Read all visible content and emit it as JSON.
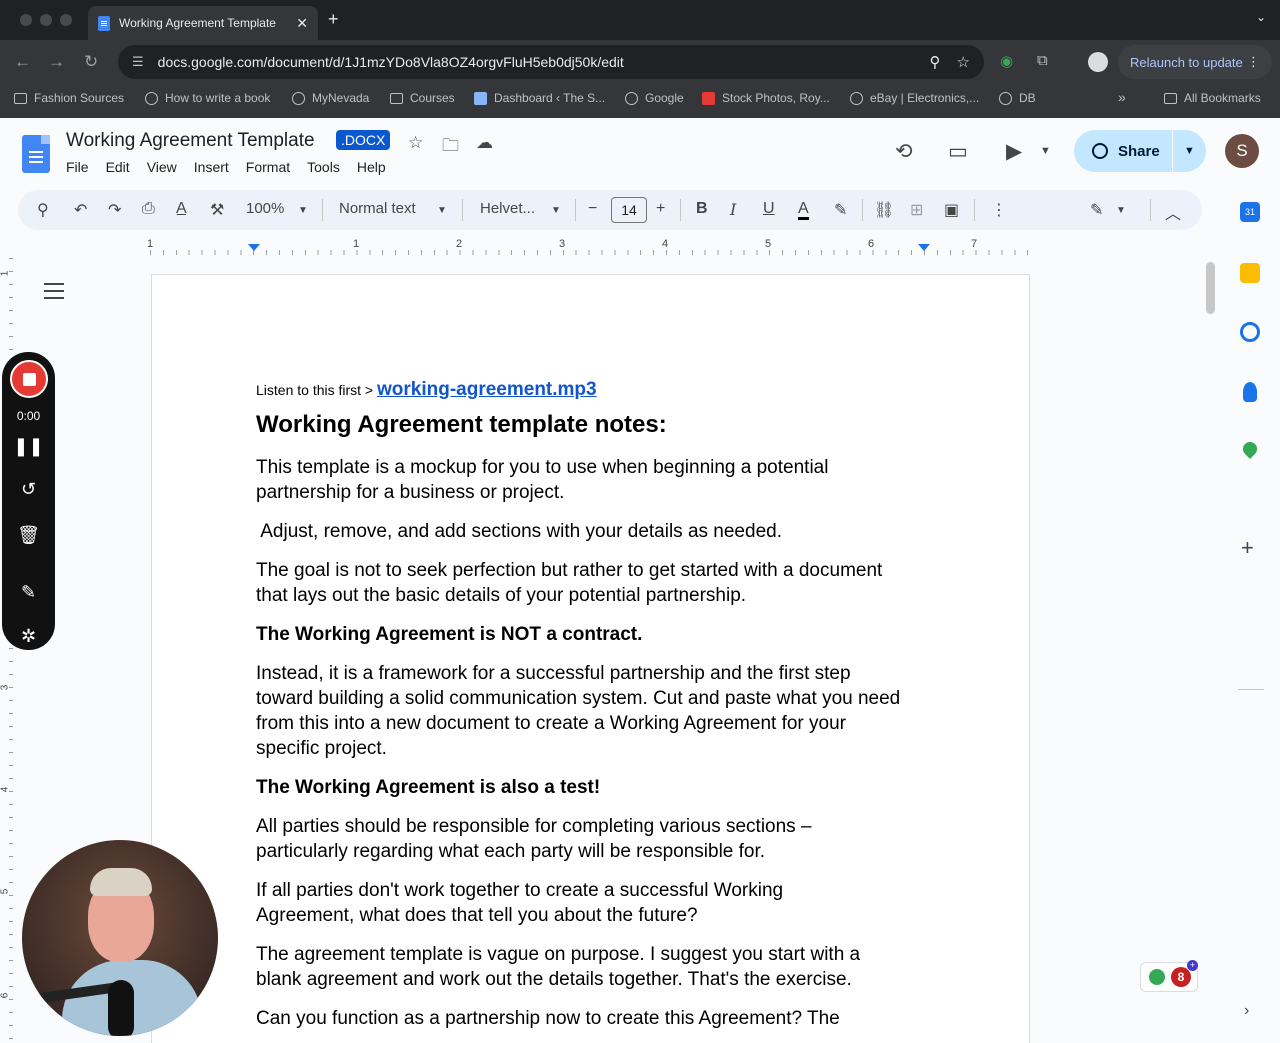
{
  "browser": {
    "tab_title": "Working Agreement Template",
    "tab_close": "✕",
    "new_tab": "+",
    "url": "docs.google.com/document/d/1J1mzYDo8Vla8OZ4orgvFluH5eb0dj50k/edit",
    "relaunch_label": "Relaunch to update",
    "bookmarks": [
      {
        "label": "Fashion Sources",
        "icon": "folder-icon"
      },
      {
        "label": "How to write a book",
        "icon": "globe-icon"
      },
      {
        "label": "MyNevada",
        "icon": "globe-icon"
      },
      {
        "label": "Courses",
        "icon": "folder-icon"
      },
      {
        "label": "Dashboard ‹ The S...",
        "icon": "site-icon"
      },
      {
        "label": "Google",
        "icon": "globe-icon"
      },
      {
        "label": "Stock Photos, Roy...",
        "icon": "site-icon"
      },
      {
        "label": "eBay | Electronics,...",
        "icon": "globe-icon"
      },
      {
        "label": "DB",
        "icon": "globe-icon"
      }
    ],
    "bookmarks_overflow": "»",
    "all_bookmarks": "All Bookmarks"
  },
  "docs": {
    "title": "Working Agreement Template",
    "format_badge": ".DOCX",
    "menu": [
      "File",
      "Edit",
      "View",
      "Insert",
      "Format",
      "Tools",
      "Help"
    ],
    "share_label": "Share",
    "avatar_initial": "S"
  },
  "toolbar": {
    "zoom": "100%",
    "style": "Normal text",
    "font": "Helvet...",
    "font_size": "14"
  },
  "ruler": {
    "numbers": [
      "1",
      "1",
      "2",
      "3",
      "4",
      "5",
      "6",
      "7"
    ],
    "vnumbers": [
      "1",
      "3",
      "4",
      "5",
      "6"
    ]
  },
  "recorder": {
    "time": "0:00"
  },
  "tracker_badge": "8",
  "document": {
    "listen_prefix": "Listen to this first > ",
    "listen_link": "working-agreement.mp3",
    "heading": "Working Agreement template notes:",
    "para1": "This template is a mockup for you to use when beginning a potential partnership for a business or project.",
    "para2": " Adjust, remove, and add sections with your details as needed.",
    "para3": "The goal is not to seek perfection but rather to get started with a document that lays out the basic details of your potential partnership.",
    "bold1": "The Working Agreement is NOT a contract.",
    "para4": "Instead, it is a framework for a successful partnership and the first step toward building a solid communication system. Cut and paste what you need from this into a new document to create a Working Agreement for your specific project.",
    "bold2": "The Working Agreement is also a test!",
    "para5": "All parties should be responsible for completing various sections – particularly regarding what each party will be responsible for.",
    "para6": "If all parties don't work together to create a successful Working Agreement, what does that tell you about the future?",
    "para7": "The agreement template is vague on purpose. I suggest you start with a blank agreement and work out the details together. That's the exercise.",
    "para8": "Can you function as a partnership now to create this Agreement? The"
  }
}
